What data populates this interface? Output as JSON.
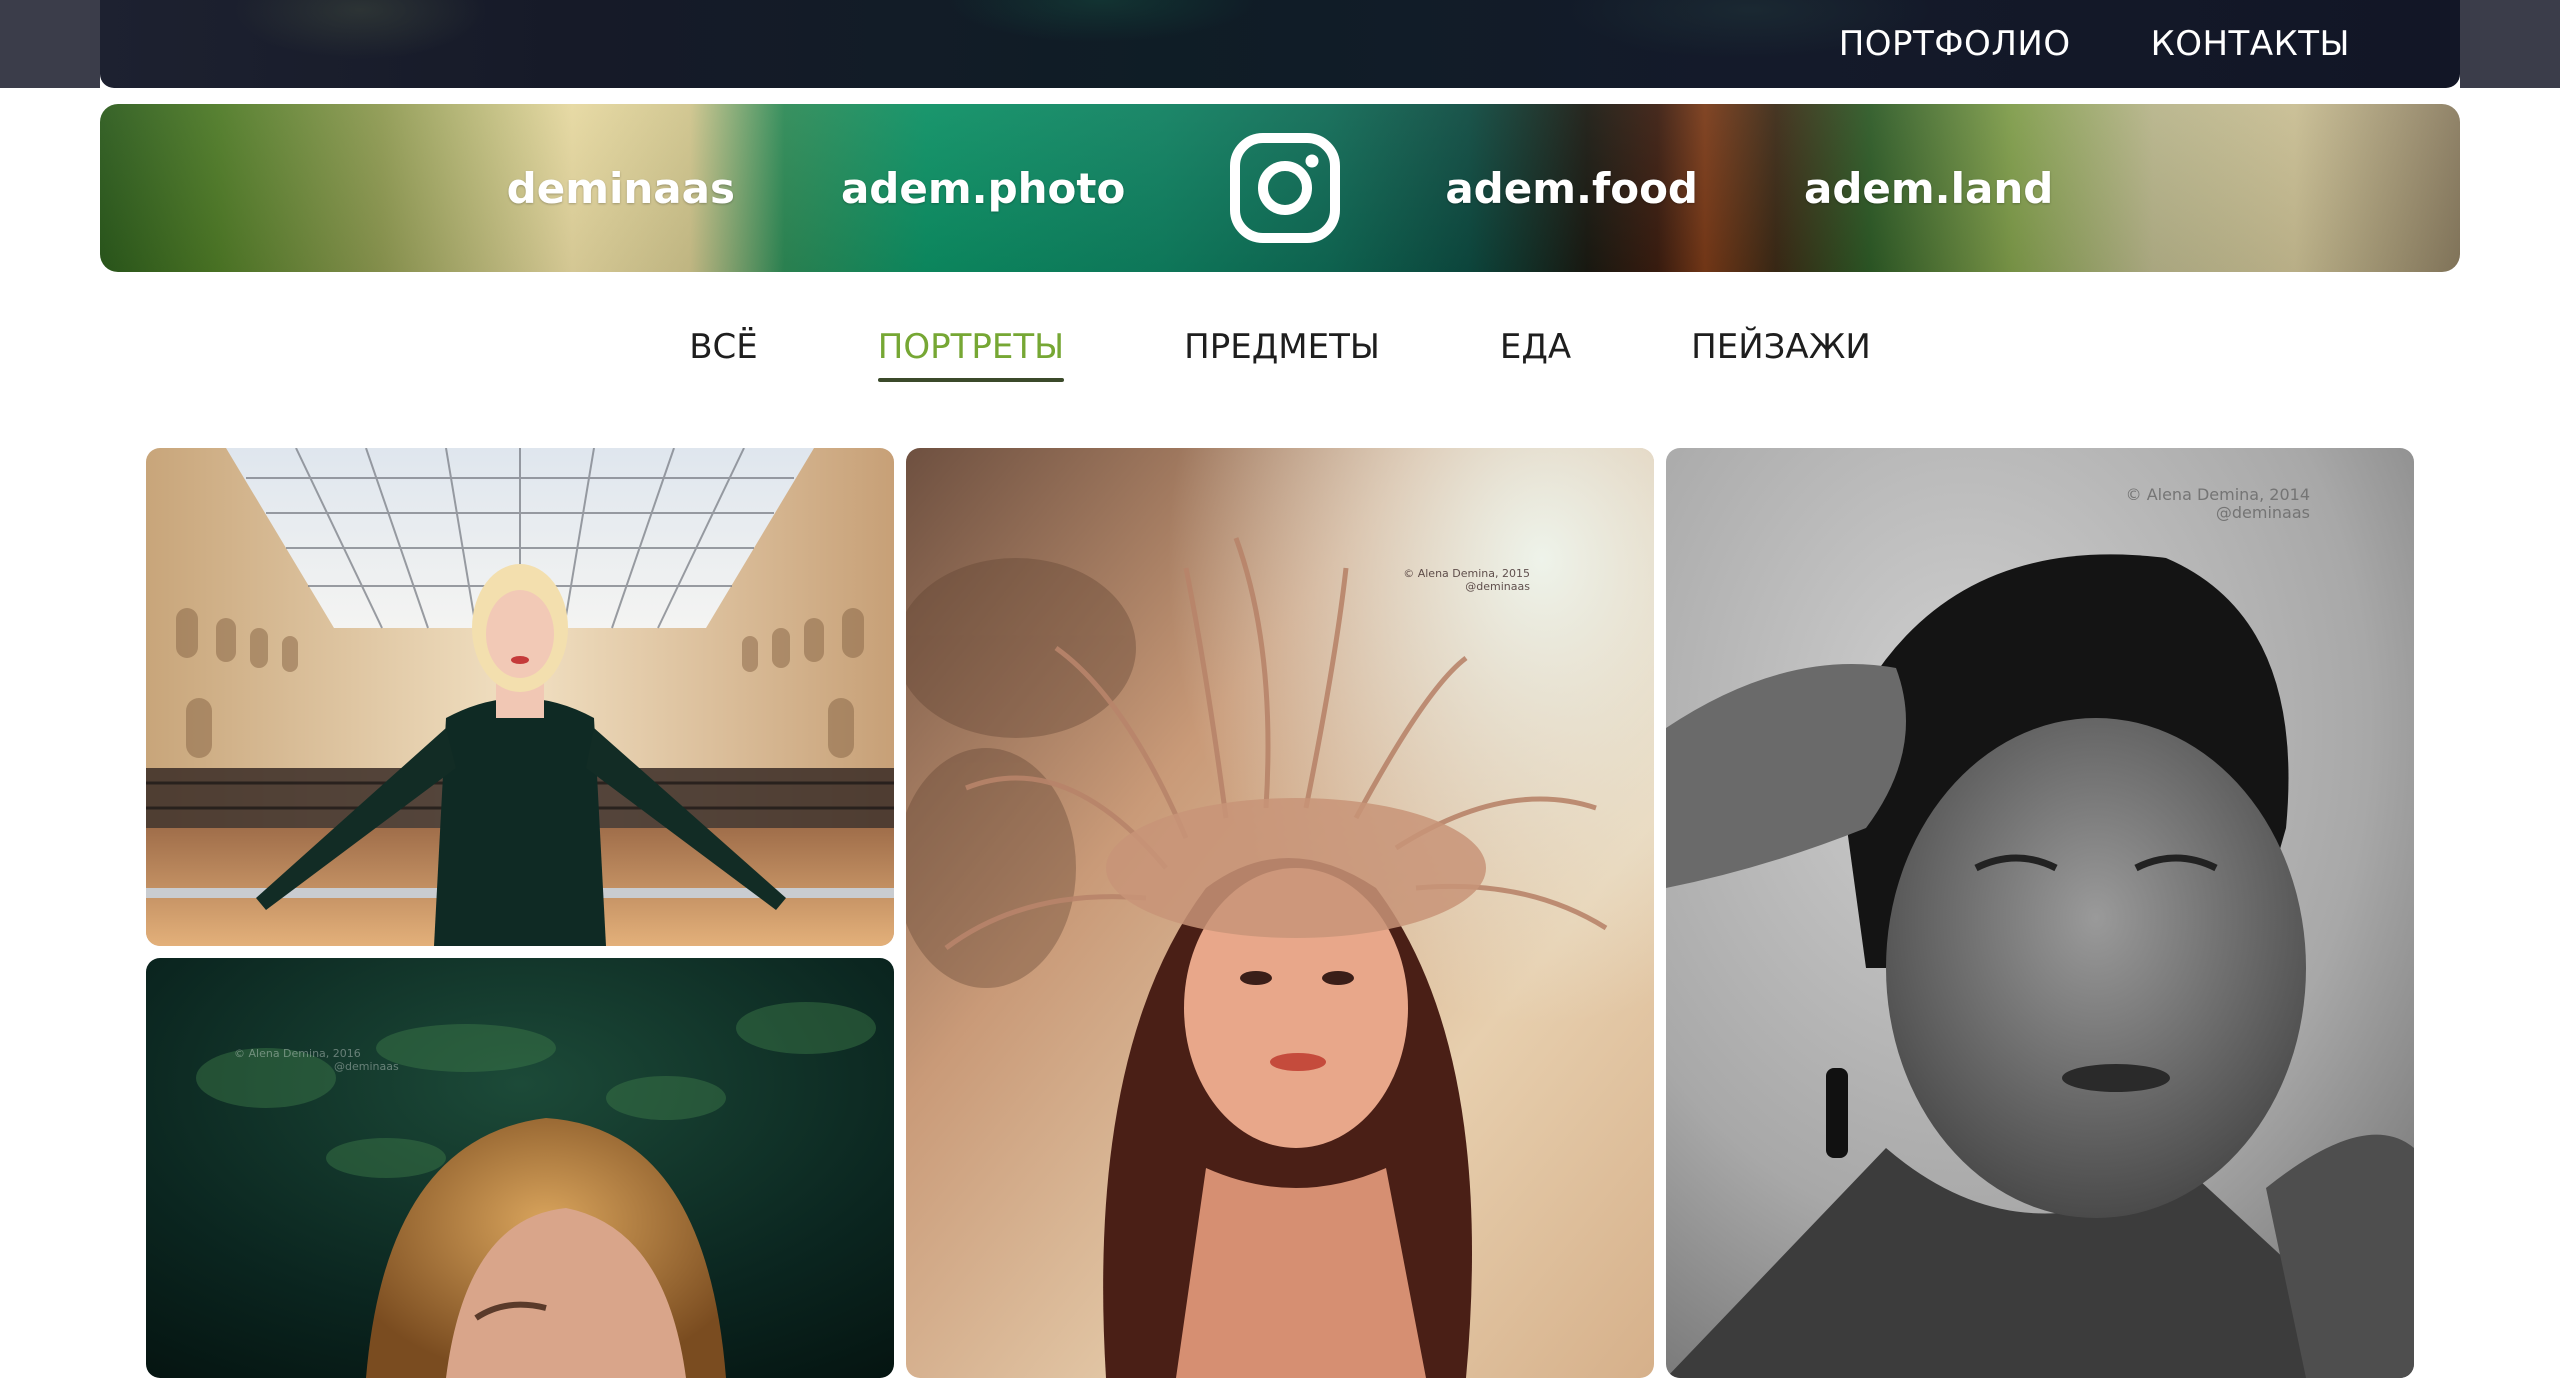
{
  "top_nav": {
    "portfolio": "ПОРТФОЛИО",
    "contacts": "КОНТАКТЫ"
  },
  "instagram_banner": {
    "accounts": [
      "deminaas",
      "adem.photo",
      "adem.food",
      "adem.land"
    ],
    "icon": "instagram-icon"
  },
  "filters": {
    "items": [
      "ВСЁ",
      "ПОРТРЕТЫ",
      "ПРЕДМЕТЫ",
      "ЕДА",
      "ПЕЙЗАЖИ"
    ],
    "active": "ПОРТРЕТЫ",
    "active_color": "#76a734"
  },
  "gallery": {
    "photos": [
      {
        "subject": "woman-in-shopping-arcade",
        "watermark_line1": "",
        "watermark_line2": ""
      },
      {
        "subject": "woman-with-wheat-wreath",
        "watermark_line1": "© Alena Demina, 2015",
        "watermark_line2": "@deminaas"
      },
      {
        "subject": "black-and-white-woman-portrait",
        "watermark_line1": "© Alena Demina, 2014",
        "watermark_line2": "@deminaas"
      },
      {
        "subject": "woman-in-green-forest",
        "watermark_line1": "© Alena Demina, 2016",
        "watermark_line2": "@deminaas"
      }
    ]
  }
}
